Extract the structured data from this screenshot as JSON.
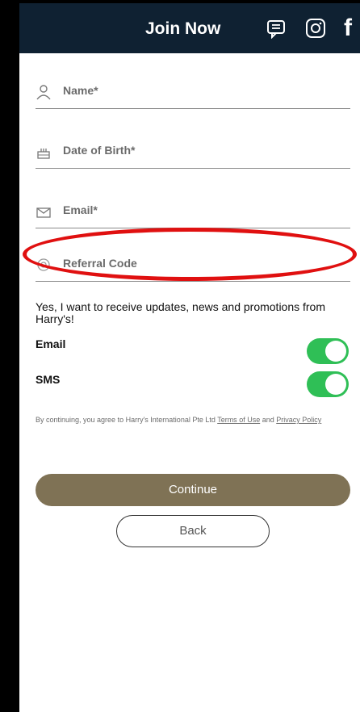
{
  "header": {
    "title": "Join Now",
    "icons": [
      "chat-icon",
      "instagram-icon",
      "facebook-icon"
    ],
    "background": "#0f2132"
  },
  "form": {
    "fields": [
      {
        "label": "Name*",
        "icon": "person-icon"
      },
      {
        "label": "Date of Birth*",
        "icon": "cake-icon"
      },
      {
        "label": "Email*",
        "icon": "envelope-icon"
      },
      {
        "label": "Referral Code",
        "icon": "ticket-icon"
      }
    ]
  },
  "preferences": {
    "consent_text": "Yes, I want to receive updates, news and promotions from Harry's!",
    "email_label": "Email",
    "sms_label": "SMS",
    "email_enabled": true,
    "sms_enabled": true,
    "toggle_color": "#2fbf56"
  },
  "terms": {
    "prefix": "By continuing, you agree to Harry's International Pte Ltd ",
    "terms_link": "Terms of Use",
    "and": " and ",
    "privacy_link": "Privacy Policy"
  },
  "buttons": {
    "continue": "Continue",
    "back": "Back",
    "accent": "#7f7255"
  },
  "annotation": {
    "highlight_color": "#e01010"
  }
}
